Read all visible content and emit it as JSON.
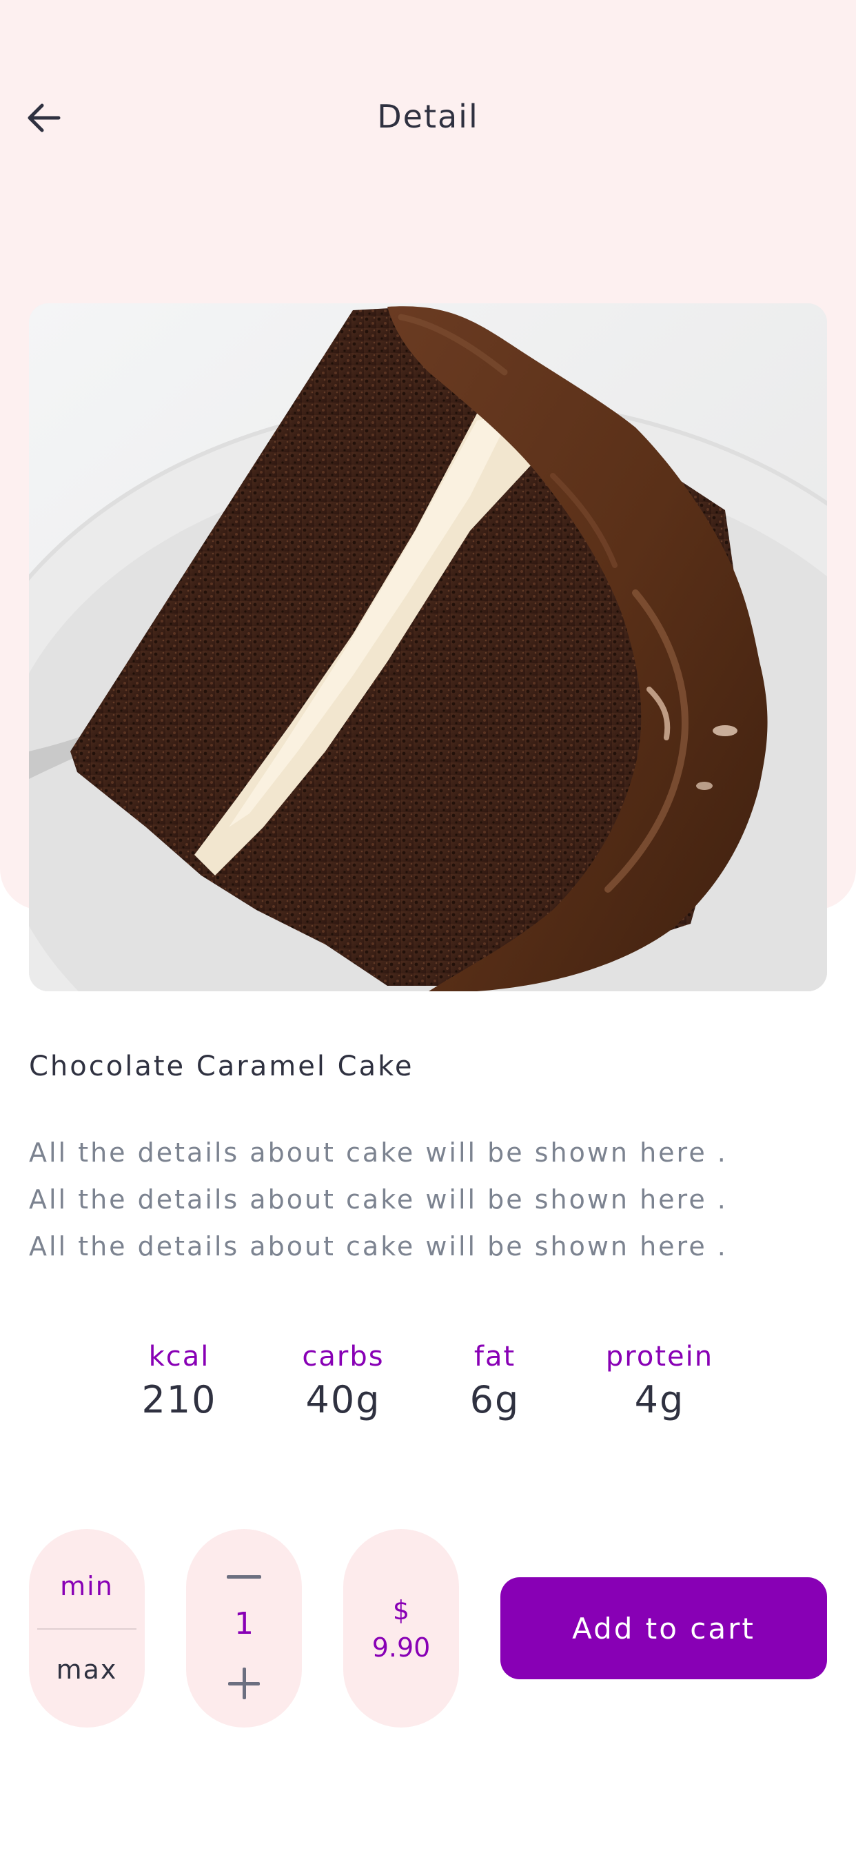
{
  "header": {
    "title": "Detail",
    "back_icon": "arrow-left-icon"
  },
  "product": {
    "image_description_icon": "cake-photo",
    "name": "Chocolate Caramel Cake",
    "description_lines": [
      "All the details about cake will be shown here .",
      "All the details about cake will be shown here .",
      "All the details about cake will be shown here ."
    ]
  },
  "nutrition": [
    {
      "label": "kcal",
      "value": "210"
    },
    {
      "label": "carbs",
      "value": "40g"
    },
    {
      "label": "fat",
      "value": "6g"
    },
    {
      "label": "protein",
      "value": "4g"
    }
  ],
  "controls": {
    "min_label": "min",
    "max_label": "max",
    "quantity": "1",
    "minus_icon": "minus-icon",
    "plus_icon": "plus-icon",
    "currency": "$",
    "price": "9.90",
    "add_to_cart_label": "Add to cart"
  },
  "colors": {
    "accent": "#8800b5",
    "hero_background": "#fdf0f0",
    "pill_background": "#fdebec",
    "text_primary": "#2f3140",
    "text_secondary": "#7c8390"
  }
}
